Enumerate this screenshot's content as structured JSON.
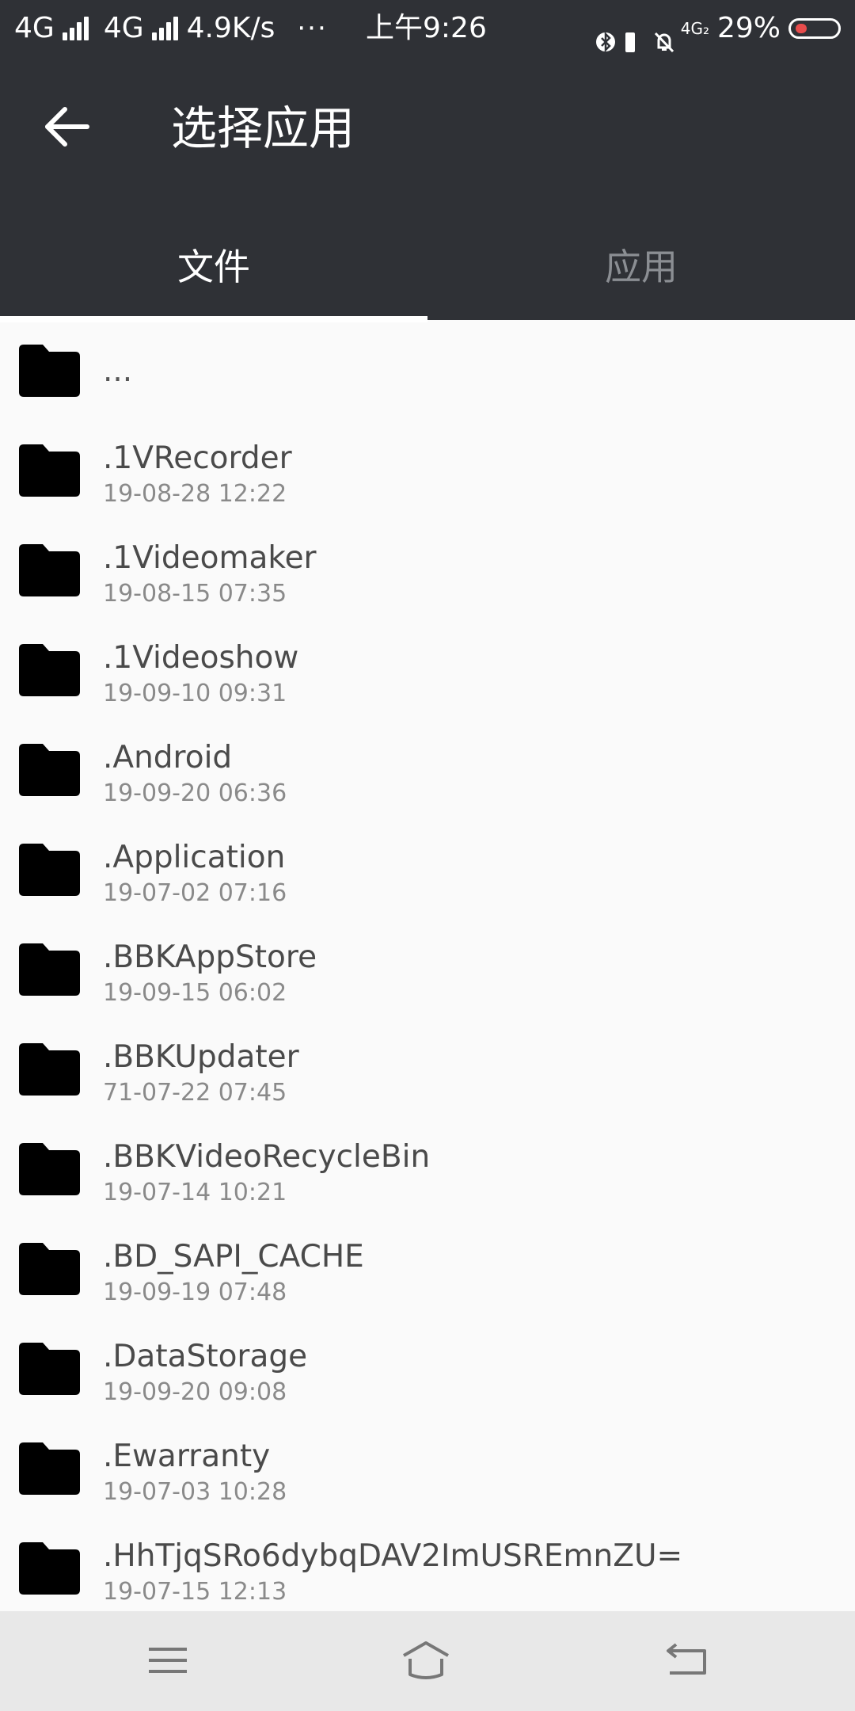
{
  "status_bar": {
    "network1": "4G",
    "network2": "4G",
    "speed": "4.9K/s",
    "more": "···",
    "time": "上午9:26",
    "data_label": "4G₂",
    "battery": "29%",
    "battery_color": "#e84c4c"
  },
  "app_bar": {
    "title": "选择应用",
    "back_icon": "arrow-back-icon"
  },
  "tabs": [
    {
      "label": "文件",
      "selected": true
    },
    {
      "label": "应用",
      "selected": false
    }
  ],
  "files": {
    "parent": {
      "name": "..."
    },
    "items": [
      {
        "name": ".1VRecorder",
        "date": "19-08-28 12:22"
      },
      {
        "name": ".1Videomaker",
        "date": "19-08-15 07:35"
      },
      {
        "name": ".1Videoshow",
        "date": "19-09-10 09:31"
      },
      {
        "name": ".Android",
        "date": "19-09-20 06:36"
      },
      {
        "name": ".Application",
        "date": "19-07-02 07:16"
      },
      {
        "name": ".BBKAppStore",
        "date": "19-09-15 06:02"
      },
      {
        "name": ".BBKUpdater",
        "date": "71-07-22 07:45"
      },
      {
        "name": ".BBKVideoRecycleBin",
        "date": "19-07-14 10:21"
      },
      {
        "name": ".BD_SAPI_CACHE",
        "date": "19-09-19 07:48"
      },
      {
        "name": ".DataStorage",
        "date": "19-09-20 09:08"
      },
      {
        "name": ".Ewarranty",
        "date": "19-07-03 10:28"
      },
      {
        "name": ".HhTjqSRo6dybqDAV2ImUSREmnZU=",
        "date": "19-07-15 12:13"
      }
    ]
  },
  "nav": {
    "menu_icon": "menu-icon",
    "home_icon": "home-icon",
    "back_icon": "back-icon"
  }
}
